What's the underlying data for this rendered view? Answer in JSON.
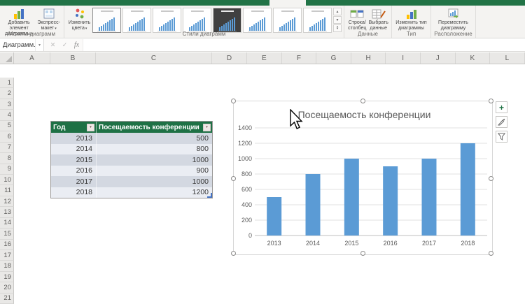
{
  "icons": {
    "dropdown": "▾",
    "up_arrow": "▲",
    "down_arrow": "▼",
    "gallery_more": "▾",
    "cancel": "✕",
    "enter": "✓",
    "fx": "fx",
    "plus": "+",
    "filter_arrow": "▾"
  },
  "ribbon": {
    "buttons": {
      "add_chart_element": "Добавить элемент диаграммы",
      "quick_layout": "Экспресс-макет",
      "change_colors": "Изменить цвета",
      "row_column": "Строка/ столбец",
      "select_data": "Выбрать данные",
      "change_chart_type": "Изменить тип диаграммы",
      "move_chart": "Переместить диаграмму"
    },
    "group_labels": {
      "layouts": "Макеты диаграмм",
      "styles": "Стили диаграмм",
      "data": "Данные",
      "type": "Тип",
      "location": "Расположение"
    },
    "style_gallery": {
      "thumbnail_count": 8,
      "selected_index": 0,
      "dark_index": 4
    }
  },
  "formula_bar": {
    "name_box_value": "Диаграмм..."
  },
  "sheet": {
    "column_headers": [
      "A",
      "B",
      "C",
      "D",
      "E",
      "F",
      "G",
      "H",
      "I",
      "J",
      "K",
      "L"
    ],
    "row_count": 21
  },
  "table": {
    "columns": [
      "Год",
      "Посещаемость конференции"
    ],
    "rows": [
      {
        "year": "2013",
        "value": "500"
      },
      {
        "year": "2014",
        "value": "800"
      },
      {
        "year": "2015",
        "value": "1000"
      },
      {
        "year": "2016",
        "value": "900"
      },
      {
        "year": "2017",
        "value": "1000"
      },
      {
        "year": "2018",
        "value": "1200"
      }
    ]
  },
  "chart_data": {
    "type": "bar",
    "title": "Посещаемость конференции",
    "categories": [
      "2013",
      "2014",
      "2015",
      "2016",
      "2017",
      "2018"
    ],
    "values": [
      500,
      800,
      1000,
      900,
      1000,
      1200
    ],
    "ylim": [
      0,
      1400
    ],
    "ytick_step": 200,
    "bar_color": "#5B9BD5",
    "grid": true,
    "legend": "none",
    "title_color": "#595959"
  },
  "colors": {
    "excel_green": "#217346",
    "table_header_green": "#1E7145",
    "bar_blue": "#5B9BD5"
  }
}
